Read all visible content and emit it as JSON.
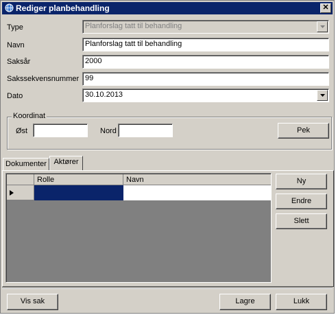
{
  "window": {
    "title": "Rediger planbehandling",
    "close_label": "✕"
  },
  "form": {
    "type_label": "Type",
    "type_value": "Planforslag tatt til behandling",
    "name_label": "Navn",
    "name_value": "Planforslag tatt til behandling",
    "year_label": "Saksår",
    "year_value": "2000",
    "seq_label": "Sakssekvensnummer",
    "seq_value": "99",
    "date_label": "Dato",
    "date_value": "30.10.2013"
  },
  "coordinate": {
    "title": "Koordinat",
    "east_label": "Øst",
    "east_value": "",
    "north_label": "Nord",
    "north_value": "",
    "pick_label": "Pek"
  },
  "tabs": [
    {
      "label": "Dokumenter",
      "active": false
    },
    {
      "label": "Aktører",
      "active": true
    }
  ],
  "grid": {
    "columns": [
      "Rolle",
      "Navn"
    ],
    "rows": [
      {
        "rolle": "",
        "navn": ""
      }
    ]
  },
  "side_buttons": {
    "new": "Ny",
    "edit": "Endre",
    "delete": "Slett"
  },
  "footer": {
    "view_case": "Vis sak",
    "save": "Lagre",
    "close": "Lukk"
  },
  "colors": {
    "titlebar": "#0a246a",
    "selection": "#0a246a",
    "grid_bg": "#808080",
    "face": "#d4d0c8"
  }
}
